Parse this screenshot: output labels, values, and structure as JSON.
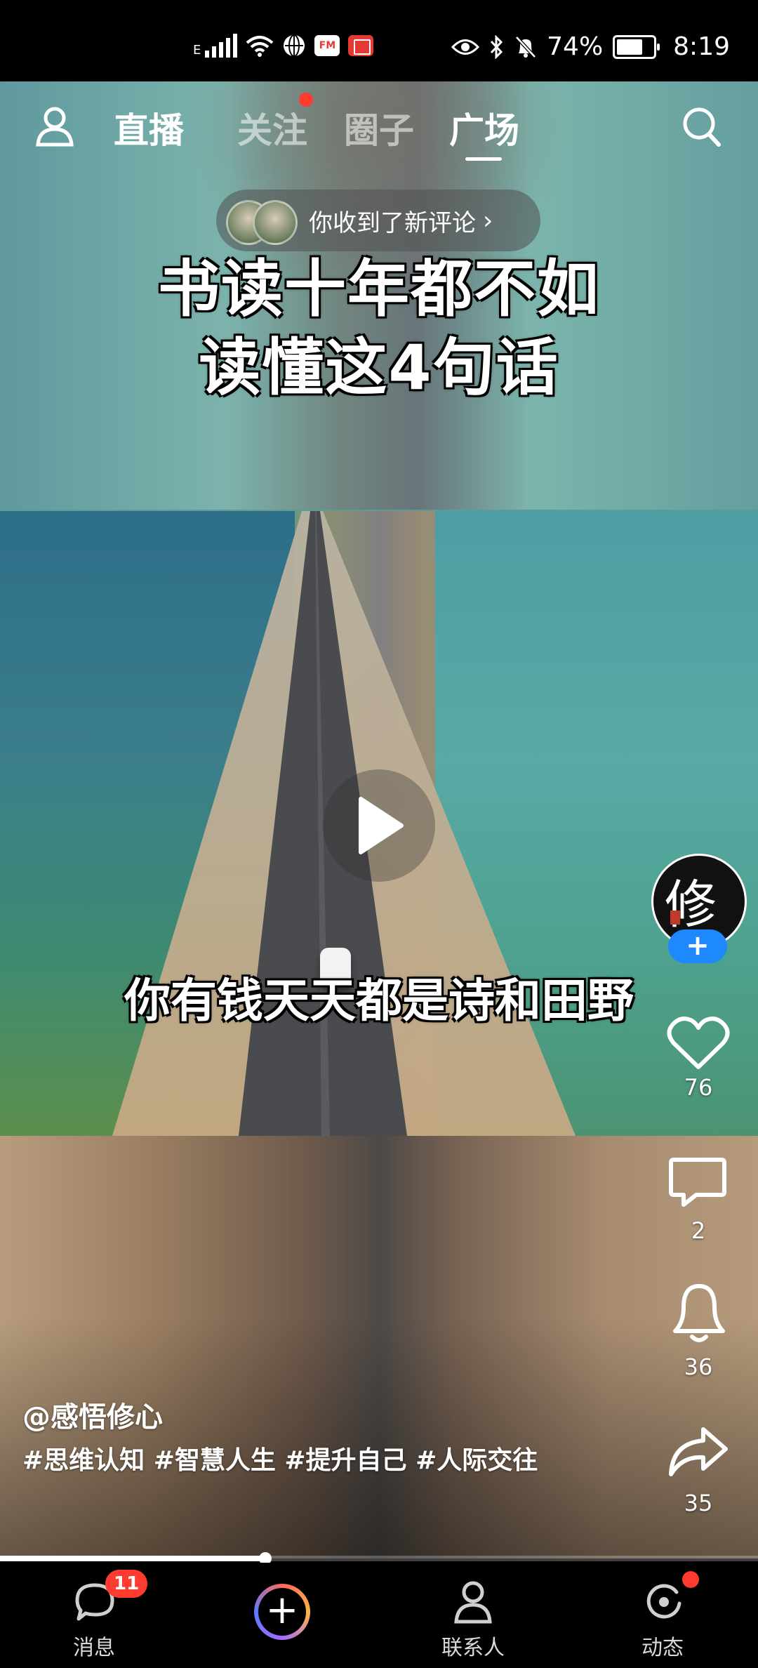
{
  "status_bar": {
    "battery": "74%",
    "time": "8:19",
    "network_label": "E",
    "fm_label": "FM"
  },
  "top_nav": {
    "live": "直播",
    "tabs": [
      {
        "label": "关注",
        "has_dot": true
      },
      {
        "label": "圈子"
      },
      {
        "label": "广场",
        "active": true
      }
    ]
  },
  "notice": {
    "text": "你收到了新评论"
  },
  "video": {
    "title_line1": "书读十年都不如",
    "title_line2": "读懂这4句话",
    "subtitle": "你有钱天天都是诗和田野",
    "progress": 0.35
  },
  "creator": {
    "avatar_text": "修",
    "follow": "+"
  },
  "actions": {
    "likes": "76",
    "comments": "2",
    "favorites": "36",
    "shares": "35"
  },
  "post": {
    "author": "@感悟修心",
    "tags": "#思维认知  #智慧人生  #提升自己  #人际交往"
  },
  "bottom_nav": {
    "messages": "消息",
    "messages_badge": "11",
    "add": "+",
    "contacts": "联系人",
    "moments": "动态"
  }
}
